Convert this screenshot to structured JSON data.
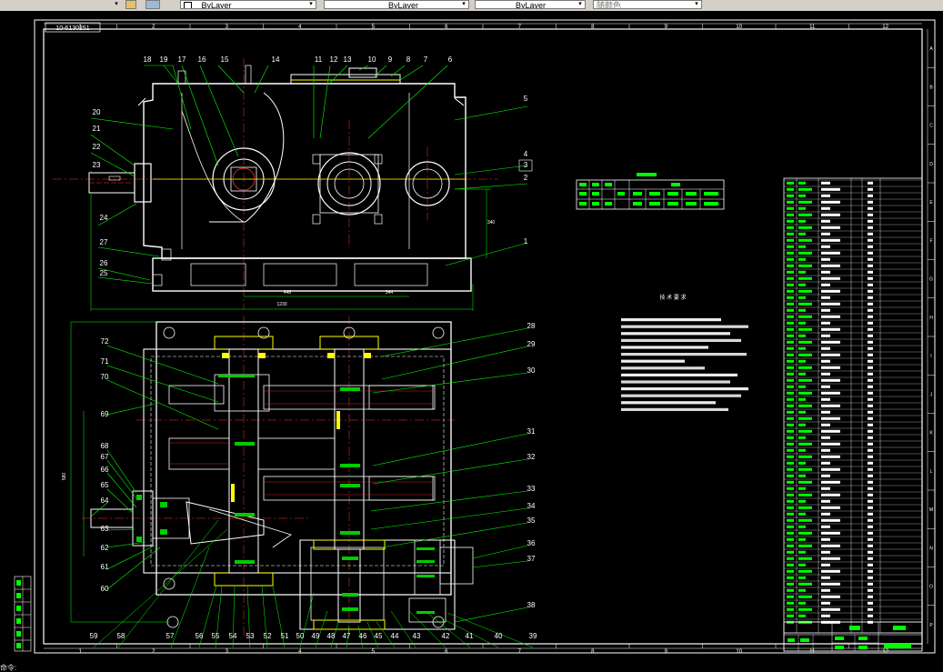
{
  "toolbar": {
    "layer_1": "ByLayer",
    "layer_2": "ByLayer",
    "layer_3": "ByLayer",
    "layer_4": "随颜色"
  },
  "frame": {
    "top_numbers": [
      "1",
      "2",
      "3",
      "4",
      "5",
      "6",
      "7",
      "8",
      "9",
      "10",
      "11",
      "12"
    ],
    "side_letters": [
      "A",
      "B",
      "C",
      "D",
      "E",
      "F",
      "G",
      "H",
      "I",
      "J",
      "K",
      "L",
      "M",
      "N",
      "O",
      "P"
    ],
    "drawing_code": "10-6130251"
  },
  "callouts_top": [
    "18",
    "19",
    "17",
    "16",
    "15",
    "14",
    "11",
    "12",
    "13",
    "10",
    "9",
    "8",
    "7",
    "6"
  ],
  "callouts_left_upper": [
    "20",
    "21",
    "22",
    "23",
    "24",
    "27",
    "26",
    "25"
  ],
  "callouts_right_upper": [
    "5",
    "4",
    "3",
    "2",
    "1"
  ],
  "callouts_left_lower": [
    "72",
    "71",
    "70",
    "69",
    "68",
    "67",
    "66",
    "65",
    "64",
    "63",
    "62",
    "61",
    "60"
  ],
  "callouts_right_lower": [
    "28",
    "29",
    "30",
    "31",
    "32",
    "33",
    "34",
    "35",
    "36",
    "37",
    "38"
  ],
  "callouts_bottom": [
    "59",
    "58",
    "57",
    "56",
    "55",
    "54",
    "53",
    "52",
    "51",
    "50",
    "49",
    "48",
    "47",
    "46",
    "45",
    "44",
    "43",
    "42",
    "41",
    "40",
    "39"
  ],
  "dims": {
    "d1": "1230",
    "d2": "448",
    "d3": "344",
    "d4": "340",
    "d5": "580"
  },
  "tech_title": "技 术 要 求",
  "status_text": "命令:"
}
